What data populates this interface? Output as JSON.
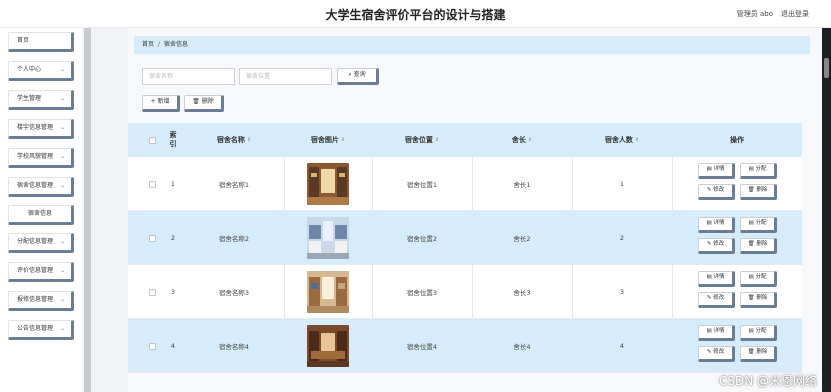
{
  "header": {
    "title": "大学生宿舍评价平台的设计与搭建",
    "admin": "管理员 abo",
    "logout": "退出登录"
  },
  "sidebar": {
    "items": [
      {
        "label": "首页",
        "has_chevron": false
      },
      {
        "label": "个人中心",
        "has_chevron": true
      },
      {
        "label": "学生管理",
        "has_chevron": true
      },
      {
        "label": "楼宇信息管理",
        "has_chevron": true
      },
      {
        "label": "学校风貌管理",
        "has_chevron": true
      },
      {
        "label": "宿舍信息管理",
        "has_chevron": true
      },
      {
        "label": "宿舍信息",
        "has_chevron": false,
        "sub": true
      },
      {
        "label": "分配信息管理",
        "has_chevron": true
      },
      {
        "label": "评价信息管理",
        "has_chevron": true
      },
      {
        "label": "报修信息管理",
        "has_chevron": true
      },
      {
        "label": "公告信息管理",
        "has_chevron": true
      }
    ]
  },
  "breadcrumb": {
    "home": "首页",
    "sep": "/",
    "current": "宿舍信息"
  },
  "search": {
    "name_placeholder": "宿舍名称",
    "location_placeholder": "宿舍位置",
    "button": "查询",
    "search_icon": "search-icon"
  },
  "toolbar": {
    "add": "+ 新增",
    "delete": "删除",
    "delete_icon": "trash-icon"
  },
  "table": {
    "headers": {
      "index": "索引",
      "name": "宿舍名称",
      "image": "宿舍图片",
      "location": "宿舍位置",
      "leader": "舍长",
      "count": "宿舍人数",
      "ops": "操作"
    },
    "rows": [
      {
        "index": "1",
        "name": "宿舍名称1",
        "location": "宿舍位置1",
        "leader": "舍长1",
        "count": "1"
      },
      {
        "index": "2",
        "name": "宿舍名称2",
        "location": "宿舍位置2",
        "leader": "舍长2",
        "count": "2"
      },
      {
        "index": "3",
        "name": "宿舍名称3",
        "location": "宿舍位置3",
        "leader": "舍长3",
        "count": "3"
      },
      {
        "index": "4",
        "name": "宿舍名称4",
        "location": "宿舍位置4",
        "leader": "舍长4",
        "count": "4"
      }
    ],
    "actions": {
      "detail": "详情",
      "assign": "分配",
      "edit": "修改",
      "delete": "删除"
    }
  },
  "watermark": "CSDN @米恩网络",
  "colors": {
    "accent": "#d7ecfb",
    "button_shadow": "#6b7d95"
  }
}
